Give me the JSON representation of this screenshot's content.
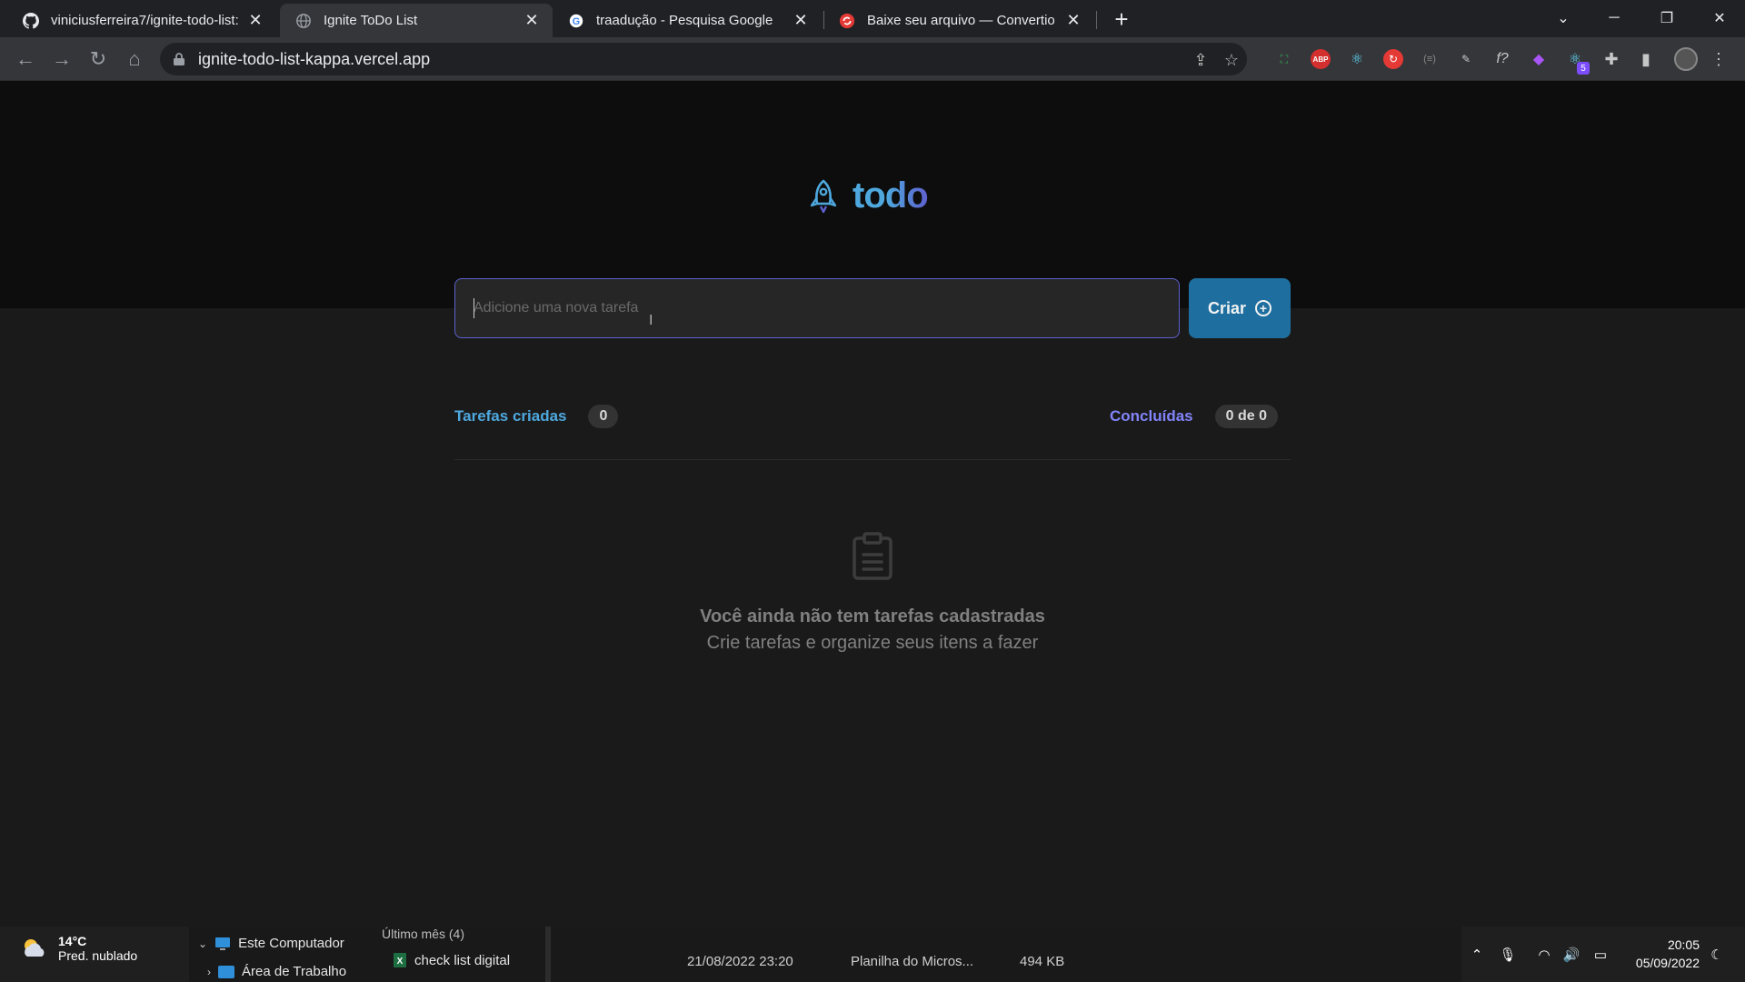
{
  "browser": {
    "tabs": [
      {
        "title": "viniciusferreira7/ignite-todo-list:",
        "favicon": "github-icon",
        "active": false
      },
      {
        "title": "Ignite ToDo List",
        "favicon": "globe-icon",
        "active": true
      },
      {
        "title": "traadução - Pesquisa Google",
        "favicon": "google-icon",
        "active": false
      },
      {
        "title": "Baixe seu arquivo — Convertio",
        "favicon": "convertio-icon",
        "active": false
      }
    ],
    "url": "ignite-todo-list-kappa.vercel.app",
    "extension_badge": "5"
  },
  "app": {
    "logo_text": "todo",
    "input": {
      "placeholder": "Adicione uma nova tarefa",
      "value": ""
    },
    "create_label": "Criar",
    "counters": {
      "created_label": "Tarefas criadas",
      "created_count": "0",
      "done_label": "Concluídas",
      "done_count": "0 de 0"
    },
    "empty": {
      "title": "Você ainda não tem tarefas cadastradas",
      "subtitle": "Crie tarefas e organize seus itens a fazer"
    },
    "colors": {
      "blue": "#4ea8de",
      "purple": "#8284fa",
      "button": "#1e6f9f"
    }
  },
  "taskbar": {
    "weather": {
      "temp": "14°C",
      "desc": "Pred. nublado"
    },
    "explorer": {
      "tree": [
        "Este Computador",
        "Área de Trabalho"
      ],
      "group_header": "Último mês (4)",
      "file": {
        "name": "check list digital",
        "date": "21/08/2022 23:20",
        "type": "Planilha do Micros...",
        "size": "494 KB"
      }
    },
    "clock": {
      "time": "20:05",
      "date": "05/09/2022"
    }
  }
}
